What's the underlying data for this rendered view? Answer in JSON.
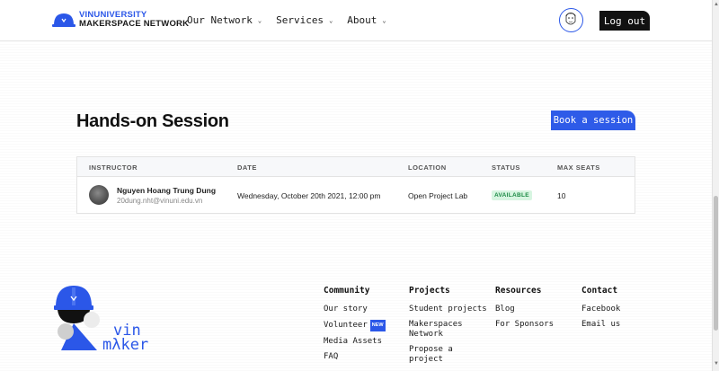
{
  "header": {
    "logo_line1": "VINUNIVERSITY",
    "logo_line2": "MAKERSPACE NETWORK",
    "nav": [
      {
        "label": "Our Network",
        "icon": "chevron-down-icon"
      },
      {
        "label": "Services",
        "icon": "chevron-down-icon"
      },
      {
        "label": "About",
        "icon": "chevron-down-icon"
      }
    ],
    "logout_label": "Log out"
  },
  "main": {
    "title": "Hands-on Session",
    "book_label": "Book a session",
    "table": {
      "columns": [
        "INSTRUCTOR",
        "DATE",
        "LOCATION",
        "STATUS",
        "MAX SEATS"
      ],
      "rows": [
        {
          "instructor_name": "Nguyen Hoang Trung Dung",
          "instructor_email": "20dung.nht@vinuni.edu.vn",
          "date": "Wednesday, October 20th 2021, 12:00 pm",
          "location": "Open Project Lab",
          "status": "AVAILABLE",
          "max_seats": "10"
        }
      ]
    }
  },
  "footer": {
    "logo_text_line1": "vin",
    "logo_text_line2": "mλker",
    "columns": [
      {
        "heading": "Community",
        "links": [
          "Our story",
          "Volunteer",
          "Media Assets",
          "FAQ"
        ],
        "new_badge": "NEW"
      },
      {
        "heading": "Projects",
        "links": [
          "Student projects",
          "Makerspaces Network",
          "Propose a project"
        ]
      },
      {
        "heading": "Resources",
        "links": [
          "Blog",
          "For Sponsors"
        ]
      },
      {
        "heading": "Contact",
        "links": [
          "Facebook",
          "Email us"
        ]
      }
    ]
  },
  "colors": {
    "accent": "#2e5be8",
    "available_bg": "#d7f5e1",
    "available_text": "#1c8a45"
  }
}
